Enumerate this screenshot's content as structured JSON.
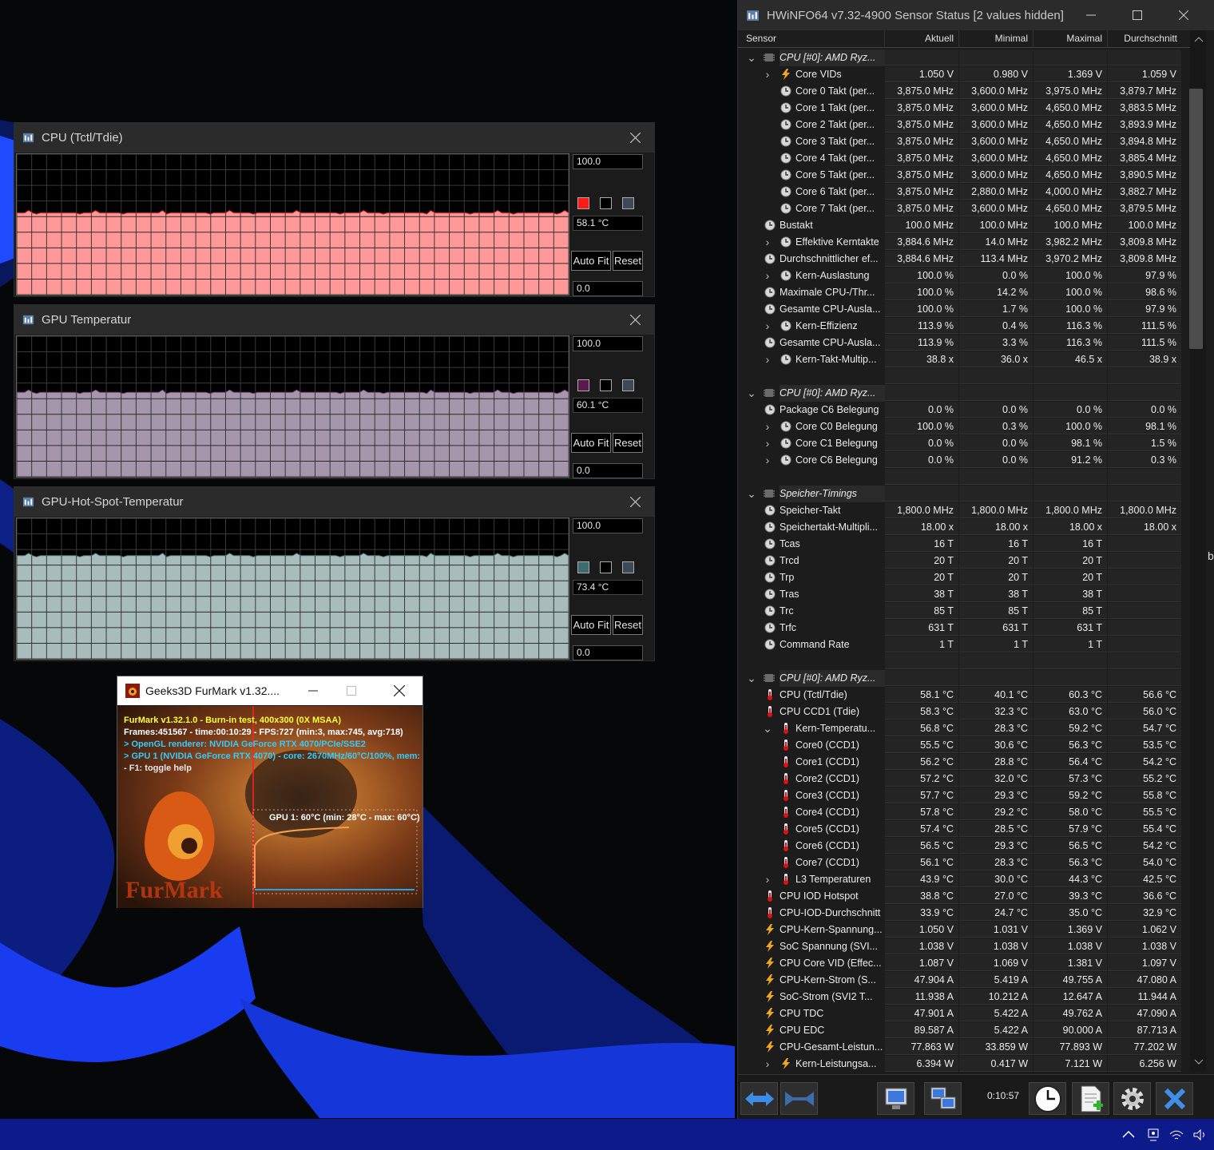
{
  "graphs": [
    {
      "title": "CPU (Tctl/Tdie)",
      "max": "100.0",
      "current": "58.1 °C",
      "min": "0.0",
      "level": 0.581,
      "fill": "#ff9999",
      "line": "#ff3030",
      "swatches": [
        "#ff1a1a",
        "#000000",
        "#3c4a56"
      ],
      "autofit": "Auto Fit",
      "reset": "Reset"
    },
    {
      "title": "GPU Temperatur",
      "max": "100.0",
      "current": "60.1 °C",
      "min": "0.0",
      "level": 0.601,
      "fill": "#a696ac",
      "line": "#7a3a7a",
      "swatches": [
        "#5a1a4e",
        "#000000",
        "#3c4a56"
      ],
      "autofit": "Auto Fit",
      "reset": "Reset"
    },
    {
      "title": "GPU-Hot-Spot-Temperatur",
      "max": "100.0",
      "current": "73.4 °C",
      "min": "0.0",
      "level": 0.734,
      "fill": "#a9bcbc",
      "line": "#4a7a7a",
      "swatches": [
        "#3e6b6b",
        "#000000",
        "#3c4a56"
      ],
      "autofit": "Auto Fit",
      "reset": "Reset"
    }
  ],
  "hwinfo": {
    "title": "HWiNFO64 v7.32-4900 Sensor Status [2 values hidden]",
    "columns": [
      "Sensor",
      "Aktuell",
      "Minimal",
      "Maximal",
      "Durchschnitt"
    ],
    "timer": "0:10:57",
    "rows": [
      {
        "t": "group",
        "label": "CPU [#0]: AMD Ryz..."
      },
      {
        "t": "row",
        "lvl": 1,
        "exp": "›",
        "icon": "bolt",
        "label": "Core VIDs",
        "v": [
          "1.050 V",
          "0.980 V",
          "1.369 V",
          "1.059 V"
        ]
      },
      {
        "t": "row",
        "lvl": 1,
        "icon": "clock",
        "label": "Core 0 Takt (per...",
        "v": [
          "3,875.0 MHz",
          "3,600.0 MHz",
          "3,975.0 MHz",
          "3,879.7 MHz"
        ]
      },
      {
        "t": "row",
        "lvl": 1,
        "icon": "clock",
        "label": "Core 1 Takt (per...",
        "v": [
          "3,875.0 MHz",
          "3,600.0 MHz",
          "4,650.0 MHz",
          "3,883.5 MHz"
        ]
      },
      {
        "t": "row",
        "lvl": 1,
        "icon": "clock",
        "label": "Core 2 Takt (per...",
        "v": [
          "3,875.0 MHz",
          "3,600.0 MHz",
          "4,650.0 MHz",
          "3,893.9 MHz"
        ]
      },
      {
        "t": "row",
        "lvl": 1,
        "icon": "clock",
        "label": "Core 3 Takt (per...",
        "v": [
          "3,875.0 MHz",
          "3,600.0 MHz",
          "4,650.0 MHz",
          "3,894.8 MHz"
        ]
      },
      {
        "t": "row",
        "lvl": 1,
        "icon": "clock",
        "label": "Core 4 Takt (per...",
        "v": [
          "3,875.0 MHz",
          "3,600.0 MHz",
          "4,650.0 MHz",
          "3,885.4 MHz"
        ]
      },
      {
        "t": "row",
        "lvl": 1,
        "icon": "clock",
        "label": "Core 5 Takt (per...",
        "v": [
          "3,875.0 MHz",
          "3,600.0 MHz",
          "4,650.0 MHz",
          "3,890.5 MHz"
        ]
      },
      {
        "t": "row",
        "lvl": 1,
        "icon": "clock",
        "label": "Core 6 Takt (per...",
        "v": [
          "3,875.0 MHz",
          "2,880.0 MHz",
          "4,000.0 MHz",
          "3,882.7 MHz"
        ]
      },
      {
        "t": "row",
        "lvl": 1,
        "icon": "clock",
        "label": "Core 7 Takt (per...",
        "v": [
          "3,875.0 MHz",
          "3,600.0 MHz",
          "4,650.0 MHz",
          "3,879.5 MHz"
        ]
      },
      {
        "t": "row",
        "lvl": 0,
        "icon": "clock",
        "label": "Bustakt",
        "v": [
          "100.0 MHz",
          "100.0 MHz",
          "100.0 MHz",
          "100.0 MHz"
        ]
      },
      {
        "t": "row",
        "lvl": 1,
        "exp": "›",
        "icon": "clock",
        "label": "Effektive Kerntakte",
        "v": [
          "3,884.6 MHz",
          "14.0 MHz",
          "3,982.2 MHz",
          "3,809.8 MHz"
        ]
      },
      {
        "t": "row",
        "lvl": 0,
        "icon": "clock",
        "label": "Durchschnittlicher ef...",
        "v": [
          "3,884.6 MHz",
          "113.4 MHz",
          "3,970.2 MHz",
          "3,809.8 MHz"
        ]
      },
      {
        "t": "row",
        "lvl": 1,
        "exp": "›",
        "icon": "clock",
        "label": "Kern-Auslastung",
        "v": [
          "100.0 %",
          "0.0 %",
          "100.0 %",
          "97.9 %"
        ]
      },
      {
        "t": "row",
        "lvl": 0,
        "icon": "clock",
        "label": "Maximale CPU-/Thr...",
        "v": [
          "100.0 %",
          "14.2 %",
          "100.0 %",
          "98.6 %"
        ]
      },
      {
        "t": "row",
        "lvl": 0,
        "icon": "clock",
        "label": "Gesamte CPU-Ausla...",
        "v": [
          "100.0 %",
          "1.7 %",
          "100.0 %",
          "97.9 %"
        ]
      },
      {
        "t": "row",
        "lvl": 1,
        "exp": "›",
        "icon": "clock",
        "label": "Kern-Effizienz",
        "v": [
          "113.9 %",
          "0.4 %",
          "116.3 %",
          "111.5 %"
        ]
      },
      {
        "t": "row",
        "lvl": 0,
        "icon": "clock",
        "label": "Gesamte CPU-Ausla...",
        "v": [
          "113.9 %",
          "3.3 %",
          "116.3 %",
          "111.5 %"
        ]
      },
      {
        "t": "row",
        "lvl": 1,
        "exp": "›",
        "icon": "clock",
        "label": "Kern-Takt-Multip...",
        "v": [
          "38.8 x",
          "36.0 x",
          "46.5 x",
          "38.9 x"
        ]
      },
      {
        "t": "blank"
      },
      {
        "t": "group",
        "label": "CPU [#0]: AMD Ryz..."
      },
      {
        "t": "row",
        "lvl": 0,
        "icon": "clock",
        "label": "Package C6 Belegung",
        "v": [
          "0.0 %",
          "0.0 %",
          "0.0 %",
          "0.0 %"
        ]
      },
      {
        "t": "row",
        "lvl": 1,
        "exp": "›",
        "icon": "clock",
        "label": "Core C0 Belegung",
        "v": [
          "100.0 %",
          "0.3 %",
          "100.0 %",
          "98.1 %"
        ]
      },
      {
        "t": "row",
        "lvl": 1,
        "exp": "›",
        "icon": "clock",
        "label": "Core C1 Belegung",
        "v": [
          "0.0 %",
          "0.0 %",
          "98.1 %",
          "1.5 %"
        ]
      },
      {
        "t": "row",
        "lvl": 1,
        "exp": "›",
        "icon": "clock",
        "label": "Core C6 Belegung",
        "v": [
          "0.0 %",
          "0.0 %",
          "91.2 %",
          "0.3 %"
        ]
      },
      {
        "t": "blank"
      },
      {
        "t": "group",
        "label": "Speicher-Timings"
      },
      {
        "t": "row",
        "lvl": 0,
        "icon": "clock",
        "label": "Speicher-Takt",
        "v": [
          "1,800.0 MHz",
          "1,800.0 MHz",
          "1,800.0 MHz",
          "1,800.0 MHz"
        ]
      },
      {
        "t": "row",
        "lvl": 0,
        "icon": "clock",
        "label": "Speichertakt-Multipli...",
        "v": [
          "18.00 x",
          "18.00 x",
          "18.00 x",
          "18.00 x"
        ]
      },
      {
        "t": "row",
        "lvl": 0,
        "icon": "clock",
        "label": "Tcas",
        "v": [
          "16 T",
          "16 T",
          "16 T",
          ""
        ]
      },
      {
        "t": "row",
        "lvl": 0,
        "icon": "clock",
        "label": "Trcd",
        "v": [
          "20 T",
          "20 T",
          "20 T",
          ""
        ]
      },
      {
        "t": "row",
        "lvl": 0,
        "icon": "clock",
        "label": "Trp",
        "v": [
          "20 T",
          "20 T",
          "20 T",
          ""
        ]
      },
      {
        "t": "row",
        "lvl": 0,
        "icon": "clock",
        "label": "Tras",
        "v": [
          "38 T",
          "38 T",
          "38 T",
          ""
        ]
      },
      {
        "t": "row",
        "lvl": 0,
        "icon": "clock",
        "label": "Trc",
        "v": [
          "85 T",
          "85 T",
          "85 T",
          ""
        ]
      },
      {
        "t": "row",
        "lvl": 0,
        "icon": "clock",
        "label": "Trfc",
        "v": [
          "631 T",
          "631 T",
          "631 T",
          ""
        ]
      },
      {
        "t": "row",
        "lvl": 0,
        "icon": "clock",
        "label": "Command Rate",
        "v": [
          "1 T",
          "1 T",
          "1 T",
          ""
        ]
      },
      {
        "t": "blank"
      },
      {
        "t": "group",
        "label": "CPU [#0]: AMD Ryz..."
      },
      {
        "t": "row",
        "lvl": 0,
        "icon": "therm",
        "label": "CPU (Tctl/Tdie)",
        "v": [
          "58.1 °C",
          "40.1 °C",
          "60.3 °C",
          "56.6 °C"
        ]
      },
      {
        "t": "row",
        "lvl": 0,
        "icon": "therm",
        "label": "CPU CCD1 (Tdie)",
        "v": [
          "58.3 °C",
          "32.3 °C",
          "63.0 °C",
          "56.0 °C"
        ]
      },
      {
        "t": "row",
        "lvl": 1,
        "exp": "⌄",
        "icon": "therm",
        "label": "Kern-Temperatu...",
        "v": [
          "56.8 °C",
          "28.3 °C",
          "59.2 °C",
          "54.7 °C"
        ]
      },
      {
        "t": "row",
        "lvl": 1,
        "icon": "therm",
        "label": "Core0 (CCD1)",
        "v": [
          "55.5 °C",
          "30.6 °C",
          "56.3 °C",
          "53.5 °C"
        ]
      },
      {
        "t": "row",
        "lvl": 1,
        "icon": "therm",
        "label": "Core1 (CCD1)",
        "v": [
          "56.2 °C",
          "28.8 °C",
          "56.4 °C",
          "54.2 °C"
        ]
      },
      {
        "t": "row",
        "lvl": 1,
        "icon": "therm",
        "label": "Core2 (CCD1)",
        "v": [
          "57.2 °C",
          "32.0 °C",
          "57.3 °C",
          "55.2 °C"
        ]
      },
      {
        "t": "row",
        "lvl": 1,
        "icon": "therm",
        "label": "Core3 (CCD1)",
        "v": [
          "57.7 °C",
          "29.3 °C",
          "59.2 °C",
          "55.8 °C"
        ]
      },
      {
        "t": "row",
        "lvl": 1,
        "icon": "therm",
        "label": "Core4 (CCD1)",
        "v": [
          "57.8 °C",
          "29.2 °C",
          "58.0 °C",
          "55.5 °C"
        ]
      },
      {
        "t": "row",
        "lvl": 1,
        "icon": "therm",
        "label": "Core5 (CCD1)",
        "v": [
          "57.4 °C",
          "28.5 °C",
          "57.9 °C",
          "55.4 °C"
        ]
      },
      {
        "t": "row",
        "lvl": 1,
        "icon": "therm",
        "label": "Core6 (CCD1)",
        "v": [
          "56.5 °C",
          "29.3 °C",
          "56.5 °C",
          "54.2 °C"
        ]
      },
      {
        "t": "row",
        "lvl": 1,
        "icon": "therm",
        "label": "Core7 (CCD1)",
        "v": [
          "56.1 °C",
          "28.3 °C",
          "56.3 °C",
          "54.0 °C"
        ]
      },
      {
        "t": "row",
        "lvl": 1,
        "exp": "›",
        "icon": "therm",
        "label": "L3 Temperaturen",
        "v": [
          "43.9 °C",
          "30.0 °C",
          "44.3 °C",
          "42.5 °C"
        ]
      },
      {
        "t": "row",
        "lvl": 0,
        "icon": "therm",
        "label": "CPU IOD Hotspot",
        "v": [
          "38.8 °C",
          "27.0 °C",
          "39.3 °C",
          "36.6 °C"
        ]
      },
      {
        "t": "row",
        "lvl": 0,
        "icon": "therm",
        "label": "CPU-IOD-Durchschnitt",
        "v": [
          "33.9 °C",
          "24.7 °C",
          "35.0 °C",
          "32.9 °C"
        ]
      },
      {
        "t": "row",
        "lvl": 0,
        "icon": "bolt",
        "label": "CPU-Kern-Spannung...",
        "v": [
          "1.050 V",
          "1.031 V",
          "1.369 V",
          "1.062 V"
        ]
      },
      {
        "t": "row",
        "lvl": 0,
        "icon": "bolt",
        "label": "SoC Spannung (SVI...",
        "v": [
          "1.038 V",
          "1.038 V",
          "1.038 V",
          "1.038 V"
        ]
      },
      {
        "t": "row",
        "lvl": 0,
        "icon": "bolt",
        "label": "CPU Core VID (Effec...",
        "v": [
          "1.087 V",
          "1.069 V",
          "1.381 V",
          "1.097 V"
        ]
      },
      {
        "t": "row",
        "lvl": 0,
        "icon": "bolt",
        "label": "CPU-Kern-Strom (S...",
        "v": [
          "47.904 A",
          "5.419 A",
          "49.755 A",
          "47.080 A"
        ]
      },
      {
        "t": "row",
        "lvl": 0,
        "icon": "bolt",
        "label": "SoC-Strom (SVI2 T...",
        "v": [
          "11.938 A",
          "10.212 A",
          "12.647 A",
          "11.944 A"
        ]
      },
      {
        "t": "row",
        "lvl": 0,
        "icon": "bolt",
        "label": "CPU TDC",
        "v": [
          "47.901 A",
          "5.422 A",
          "49.762 A",
          "47.090 A"
        ]
      },
      {
        "t": "row",
        "lvl": 0,
        "icon": "bolt",
        "label": "CPU EDC",
        "v": [
          "89.587 A",
          "5.422 A",
          "90.000 A",
          "87.713 A"
        ]
      },
      {
        "t": "row",
        "lvl": 0,
        "icon": "bolt",
        "label": "CPU-Gesamt-Leistun...",
        "v": [
          "77.863 W",
          "33.859 W",
          "77.893 W",
          "77.202 W"
        ]
      },
      {
        "t": "row",
        "lvl": 1,
        "exp": "›",
        "icon": "bolt",
        "label": "Kern-Leistungsa...",
        "v": [
          "6.394 W",
          "0.417 W",
          "7.121 W",
          "6.256 W"
        ]
      }
    ]
  },
  "furmark": {
    "title": "Geeks3D FurMark v1.32....",
    "line1": "FurMark v1.32.1.0 - Burn-in test, 400x300 (0X MSAA)",
    "line2": "Frames:451567 - time:00:10:29 - FPS:727 (min:3, max:745, avg:718)",
    "line3": "> OpenGL renderer: NVIDIA GeForce RTX 4070/PCIe/SSE2",
    "line4": "> GPU 1 (NVIDIA GeForce RTX 4070) - core: 2670MHz/60°C/100%, mem:",
    "line5": "- F1: toggle help",
    "gpu_label": "GPU 1: 60°C (min: 28°C - max: 60°C)",
    "logo": "FurMark"
  },
  "colors": {
    "line1": "#ffff33",
    "line2": "#ffffff",
    "line3": "#33ccff",
    "accent_blue": "#2b57ff"
  }
}
